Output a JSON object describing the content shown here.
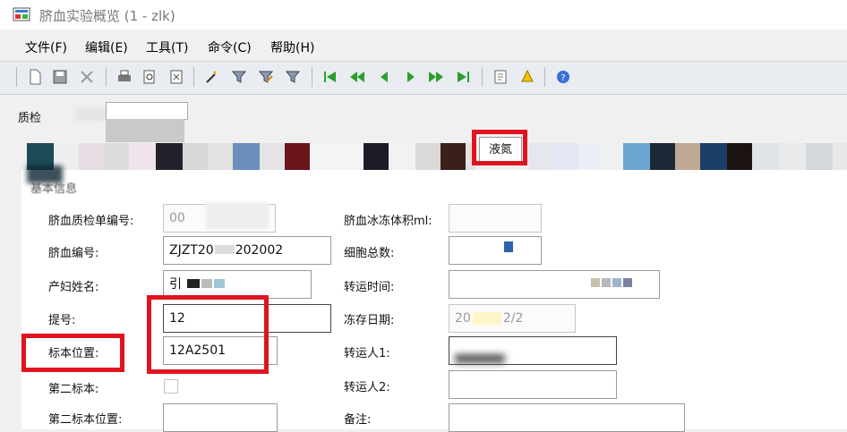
{
  "window": {
    "title": "脐血实验概览 (1 - zlk)"
  },
  "menu": [
    "文件(F)",
    "编辑(E)",
    "工具(T)",
    "命令(C)",
    "帮助(H)"
  ],
  "toolbar": {
    "icons": [
      "new-icon",
      "save-icon",
      "delete-icon",
      "print-icon",
      "print-preview-icon",
      "export-icon",
      "filter-wand-icon",
      "filter-icon",
      "filter-edit-icon",
      "filter-clear-icon",
      "first-record-icon",
      "prev-page-icon",
      "prev-record-icon",
      "next-record-icon",
      "next-page-icon",
      "last-record-icon",
      "report-icon",
      "alert-icon",
      "help-icon"
    ],
    "accent": "#2aa02a"
  },
  "quality_check": {
    "label": "质检"
  },
  "tabs": {
    "active_label": "液氮"
  },
  "basic_info": {
    "group_title": "基本信息",
    "fields": {
      "qc_number": {
        "label": "脐血质检单编号:",
        "value": "00"
      },
      "frozen_volume": {
        "label": "脐血冰冻体积ml:",
        "value": ""
      },
      "cord_blood_number": {
        "label": "脐血编号:",
        "value": "ZJZT20",
        "value_suffix": "202002"
      },
      "total_cells": {
        "label": "细胞总数:",
        "value": ""
      },
      "mother_name": {
        "label": "产妇姓名:",
        "value": "引"
      },
      "transfer_time": {
        "label": "转运时间:",
        "value": ""
      },
      "rack_number": {
        "label": "提号:",
        "value": "12"
      },
      "freeze_date": {
        "label": "冻存日期:",
        "value": "20",
        "value_suffix": "2/2"
      },
      "sample_location": {
        "label": "标本位置:",
        "value": "12A2501"
      },
      "transporter1": {
        "label": "转运人1:",
        "value": ""
      },
      "second_sample": {
        "label": "第二标本:"
      },
      "transporter2": {
        "label": "转运人2:",
        "value": ""
      },
      "second_sample_location": {
        "label": "第二标本位置:",
        "value": ""
      },
      "remarks": {
        "label": "备注:",
        "value": ""
      }
    }
  },
  "colors": {
    "highlight_red": "#e0141e"
  }
}
